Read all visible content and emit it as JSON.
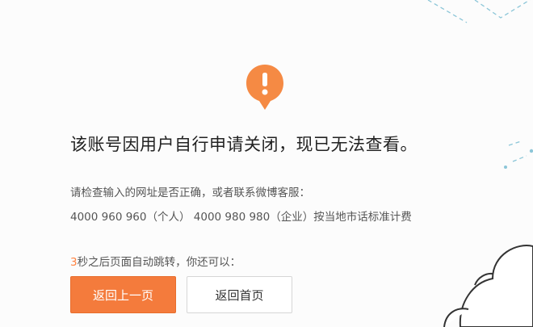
{
  "message": {
    "title": "该账号因用户自行申请关闭，现已无法查看。",
    "help_text": "请检查输入的网址是否正确，或者联系微博客服：",
    "hotline": "4000 960 960（个人） 4000 980 980（企业）按当地市话标准计费"
  },
  "redirect": {
    "seconds": "3",
    "text": "秒之后页面自动跳转，你还可以："
  },
  "buttons": {
    "back_label": "返回上一页",
    "home_label": "返回首页"
  },
  "colors": {
    "accent": "#f47b3c",
    "alert_icon": "#f58a44"
  },
  "icons": {
    "alert": "exclamation-icon"
  }
}
